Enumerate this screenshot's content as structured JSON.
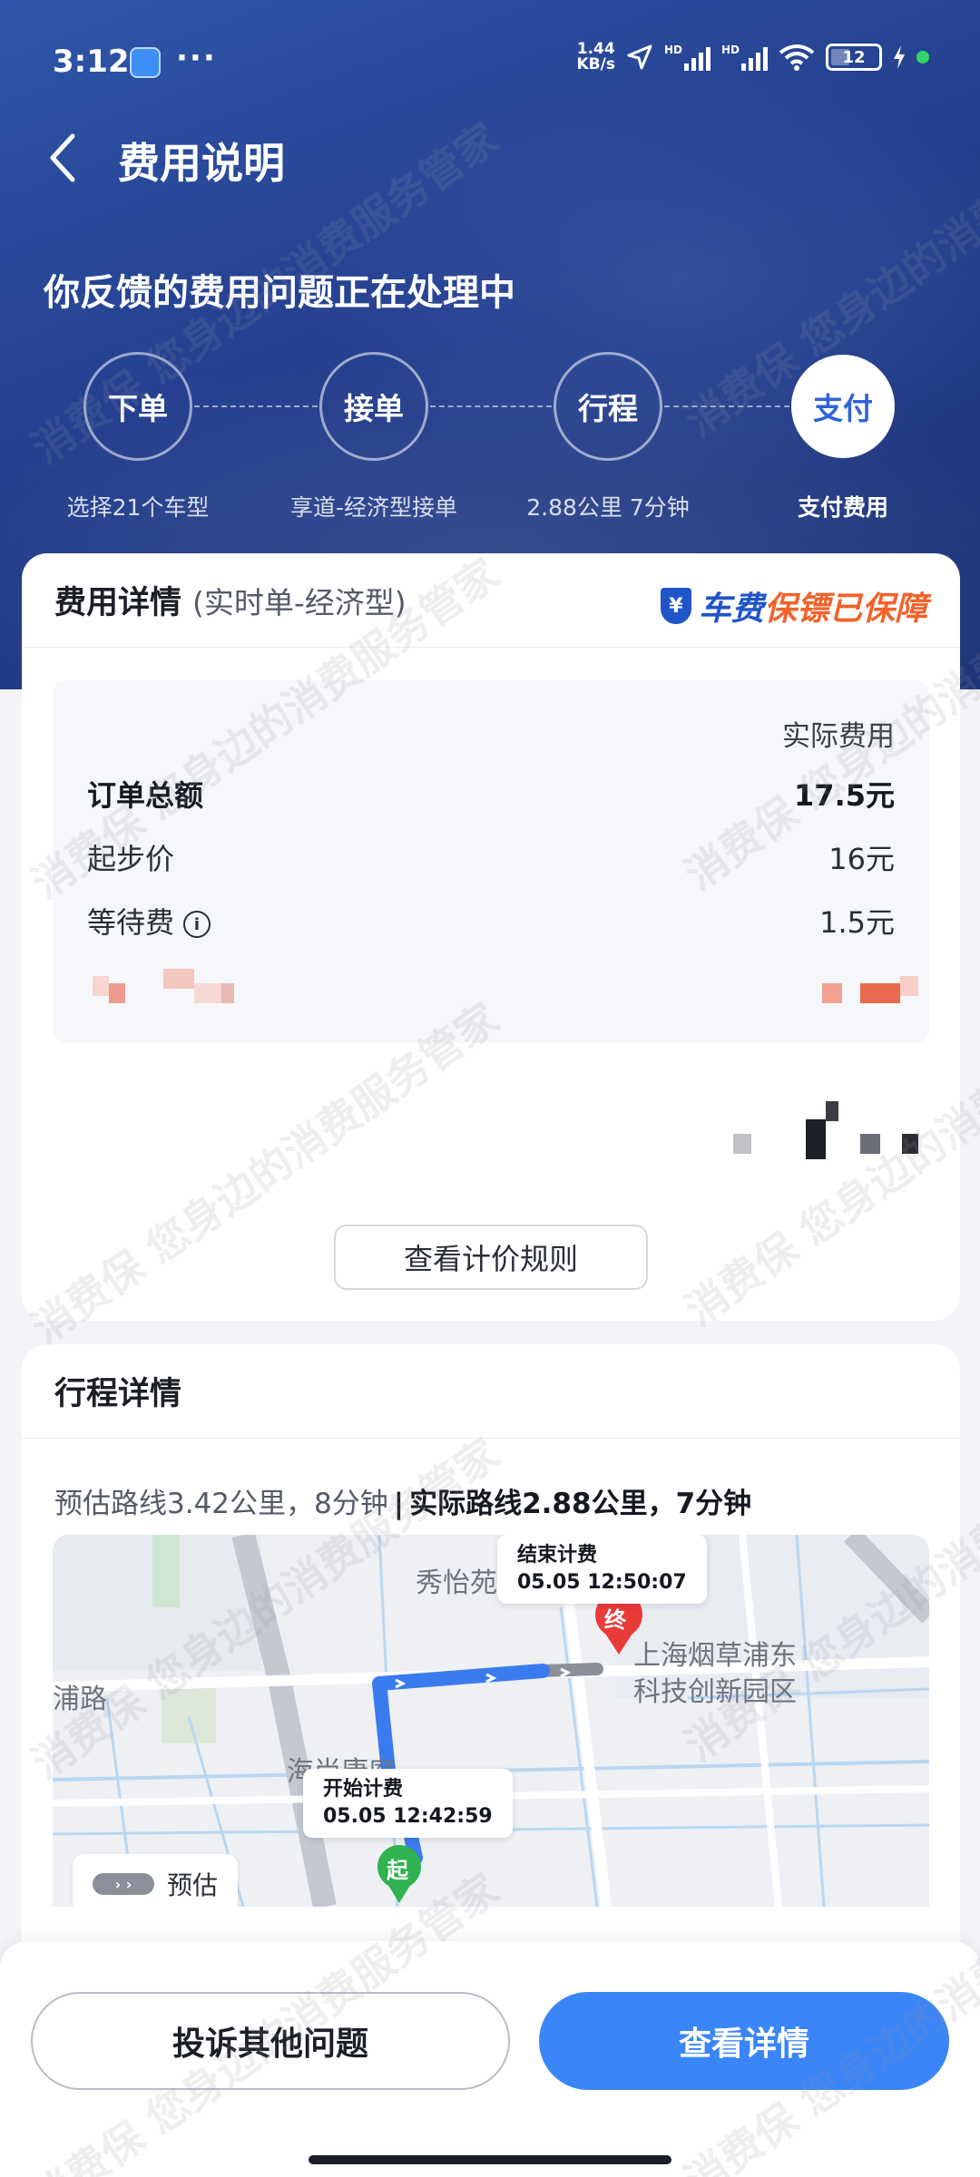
{
  "status_bar": {
    "time": "3:12",
    "dots": "···",
    "net_speed_value": "1.44",
    "net_speed_unit": "KB/s",
    "hd1": "HD",
    "hd2": "HD",
    "battery": "12"
  },
  "nav": {
    "title": "费用说明"
  },
  "progress": {
    "title": "你反馈的费用问题正在处理中",
    "steps": [
      {
        "label": "下单",
        "sub": "选择21个车型"
      },
      {
        "label": "接单",
        "sub": "享道-经济型接单"
      },
      {
        "label": "行程",
        "sub": "2.88公里 7分钟"
      },
      {
        "label": "支付",
        "sub": "支付费用"
      }
    ],
    "active_step": 3
  },
  "fee_card": {
    "title": "费用详情",
    "subtitle": "(实时单-经济型)",
    "badge": {
      "shield_symbol": "¥",
      "text_a": "车费",
      "text_b": "保镖",
      "text_c": "已保障"
    },
    "column_header": "实际费用",
    "rows": [
      {
        "label": "订单总额",
        "value": "17.5元"
      },
      {
        "label": "起步价",
        "value": "16元"
      },
      {
        "label": "等待费",
        "value": "1.5元"
      }
    ],
    "rule_button": "查看计价规则"
  },
  "trip_card": {
    "title": "行程详情",
    "estimated": "预估路线3.42公里，8分钟",
    "separator": "|",
    "actual_prefix": "实际路线",
    "actual_value": "2.88公里，7分钟",
    "map": {
      "end_callout_title": "结束计费",
      "end_callout_time": "05.05 12:50:07",
      "start_callout_title": "开始计费",
      "start_callout_time": "05.05 12:42:59",
      "end_marker": "终",
      "start_marker": "起",
      "labels": {
        "xiuyiyuan": "秀怡苑",
        "park_line1": "上海烟草浦东",
        "park_line2": "科技创新园区",
        "road": "浦路",
        "community": "海尚康庭"
      },
      "legend": "预估",
      "colors": {
        "route": "#3a7cf0",
        "estimate": "#8a8f99"
      }
    }
  },
  "bottom": {
    "complain_button": "投诉其他问题",
    "details_button": "查看详情"
  },
  "watermark_text": "消费保 您身边的消费服务管家",
  "colors": {
    "primary": "#3a85f7",
    "header_dark": "#243f8e",
    "badge_blue": "#1f55c8",
    "badge_orange": "#f2622b"
  }
}
